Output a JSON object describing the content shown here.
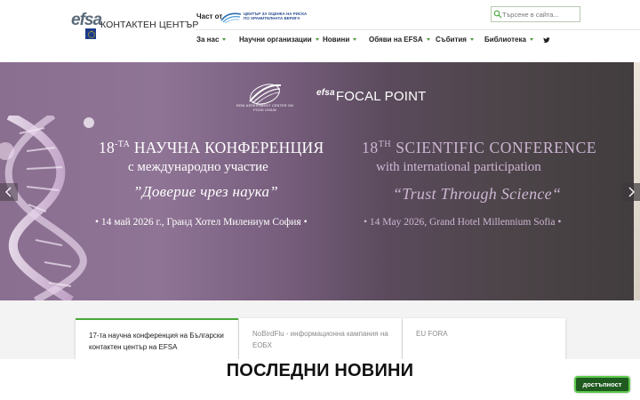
{
  "header": {
    "logo_mark": "efsa",
    "logo_title": "КОНТАКТЕН ЦЕНТЪР",
    "part_of": "Част от",
    "partner_lines": [
      "ЦЕНТЪР ЗА ОЦЕНКА НА РИСКА",
      "ПО ХРАНИТЕЛНАТА ВЕРИГА"
    ],
    "search_placeholder": "Търсене в сайта..."
  },
  "nav": {
    "items": [
      {
        "label": "За нас"
      },
      {
        "label": "Научни организации"
      },
      {
        "label": "Новини"
      },
      {
        "label": "Обяви на EFSA"
      },
      {
        "label": "Събития"
      },
      {
        "label": "Библиотека"
      }
    ],
    "social_icon": "twitter-icon"
  },
  "banner": {
    "rac_text": "RISK ASSESSMENT CENTER ON FOOD CHAIN",
    "fp_efsa": "efsa",
    "fp_label": "FOCAL POINT",
    "bg": {
      "title_num": "18",
      "title_sup": "-ТА",
      "title_rest": " НАУЧНА КОНФЕРЕНЦИЯ",
      "subtitle": "с международно участие",
      "motto": "”Доверие чрез наука”",
      "date": "• 14 май 2026 г.,  Гранд Хотел Милениум София •"
    },
    "en": {
      "title_num": "18",
      "title_sup": "TH",
      "title_rest": " SCIENTIFIC  CONFERENCE",
      "subtitle": "with international participation",
      "motto": "“Trust Through Science“",
      "date": "• 14 May 2026, Grand Hotel Millennium Sofia •"
    }
  },
  "cards": [
    {
      "text": "17-та научна конференция на Български контактен център на EFSA"
    },
    {
      "text": "NoBirdFlu - информационна кампания на ЕОБХ"
    },
    {
      "text": "EU FORA"
    }
  ],
  "news": {
    "title": "ПОСЛЕДНИ НОВИНИ"
  },
  "accessibility": {
    "label": "достъпност"
  },
  "colors": {
    "accent_green": "#4aa83a",
    "access_bg": "#1f5a1f"
  }
}
